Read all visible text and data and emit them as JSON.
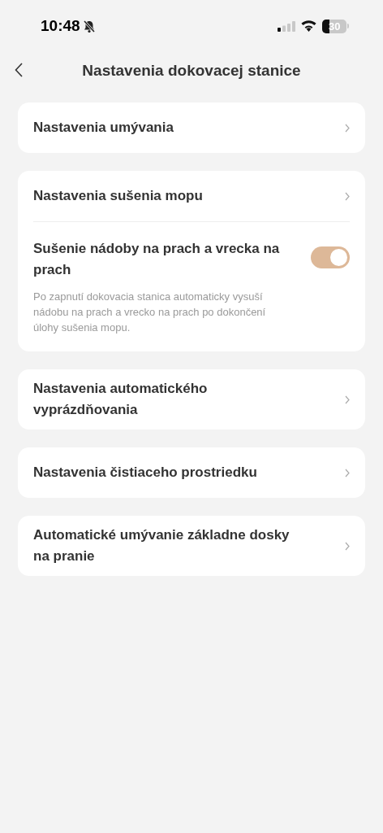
{
  "status_bar": {
    "time": "10:48",
    "battery": "30"
  },
  "header": {
    "title": "Nastavenia dokovacej stanice"
  },
  "groups": [
    {
      "items": [
        {
          "kind": "link",
          "label": "Nastavenia umývania"
        }
      ]
    },
    {
      "items": [
        {
          "kind": "link",
          "label": "Nastavenia sušenia mopu"
        },
        {
          "kind": "toggle",
          "label": "Sušenie nádoby na prach a vrecka na prach",
          "on": true,
          "description": "Po zapnutí dokovacia stanica automaticky vysuší nádobu na prach a vrecko na prach po dokončení úlohy sušenia mopu."
        }
      ]
    },
    {
      "items": [
        {
          "kind": "link",
          "label": "Nastavenia automatického vyprázdňovania"
        }
      ]
    },
    {
      "items": [
        {
          "kind": "link",
          "label": "Nastavenia čistiaceho prostriedku"
        }
      ]
    },
    {
      "items": [
        {
          "kind": "link",
          "label": "Automatické umývanie základne dosky na pranie"
        }
      ]
    }
  ]
}
